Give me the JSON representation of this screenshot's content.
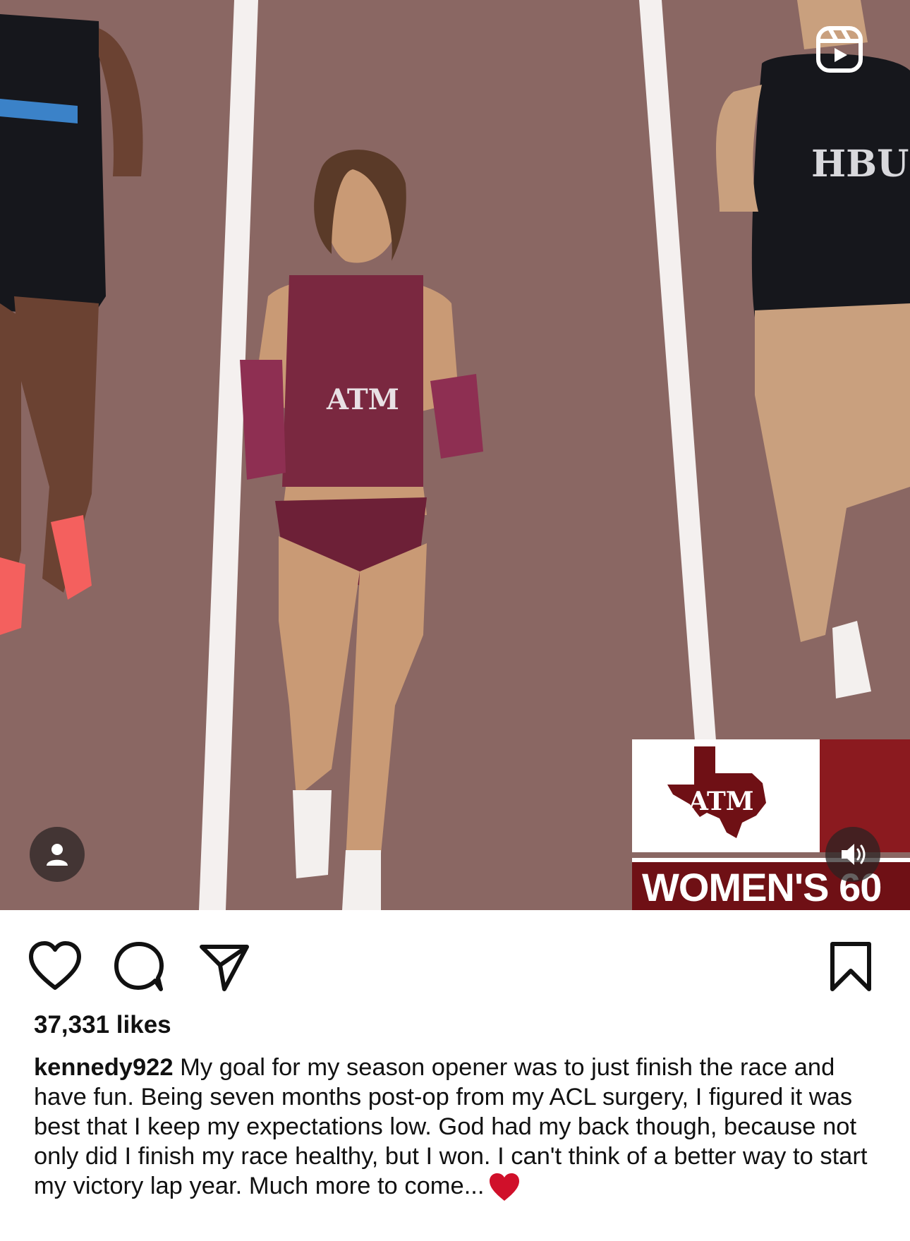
{
  "post": {
    "likes_text": "37,331 likes",
    "caption": {
      "username": "kennedy922",
      "text": "My goal for my season opener was to just finish the race and have fun. Being seven months post-op from my ACL surgery, I figured it was best that I keep my expectations low. God had my back though, because not only did I finish my race healthy, but I won. I can't think of a better way to start my victory lap year. Much more to come...",
      "trailing_emoji": "heart-emoji"
    }
  },
  "media": {
    "type": "reel-video",
    "overlay": {
      "logo_text": "ATM",
      "caption_text": "WOMEN'S 60"
    },
    "jersey_text_right": "HBU",
    "jersey_text_center": "ATM"
  },
  "icons": {
    "reels": "reels-icon",
    "user_tag": "user-icon",
    "mute": "speaker-icon",
    "like": "heart-icon",
    "comment": "comment-icon",
    "share": "send-icon",
    "save": "bookmark-icon"
  },
  "colors": {
    "track": "#8a6763",
    "maroon": "#6f1015",
    "heart_emoji": "#d0102a",
    "text": "#111111"
  }
}
